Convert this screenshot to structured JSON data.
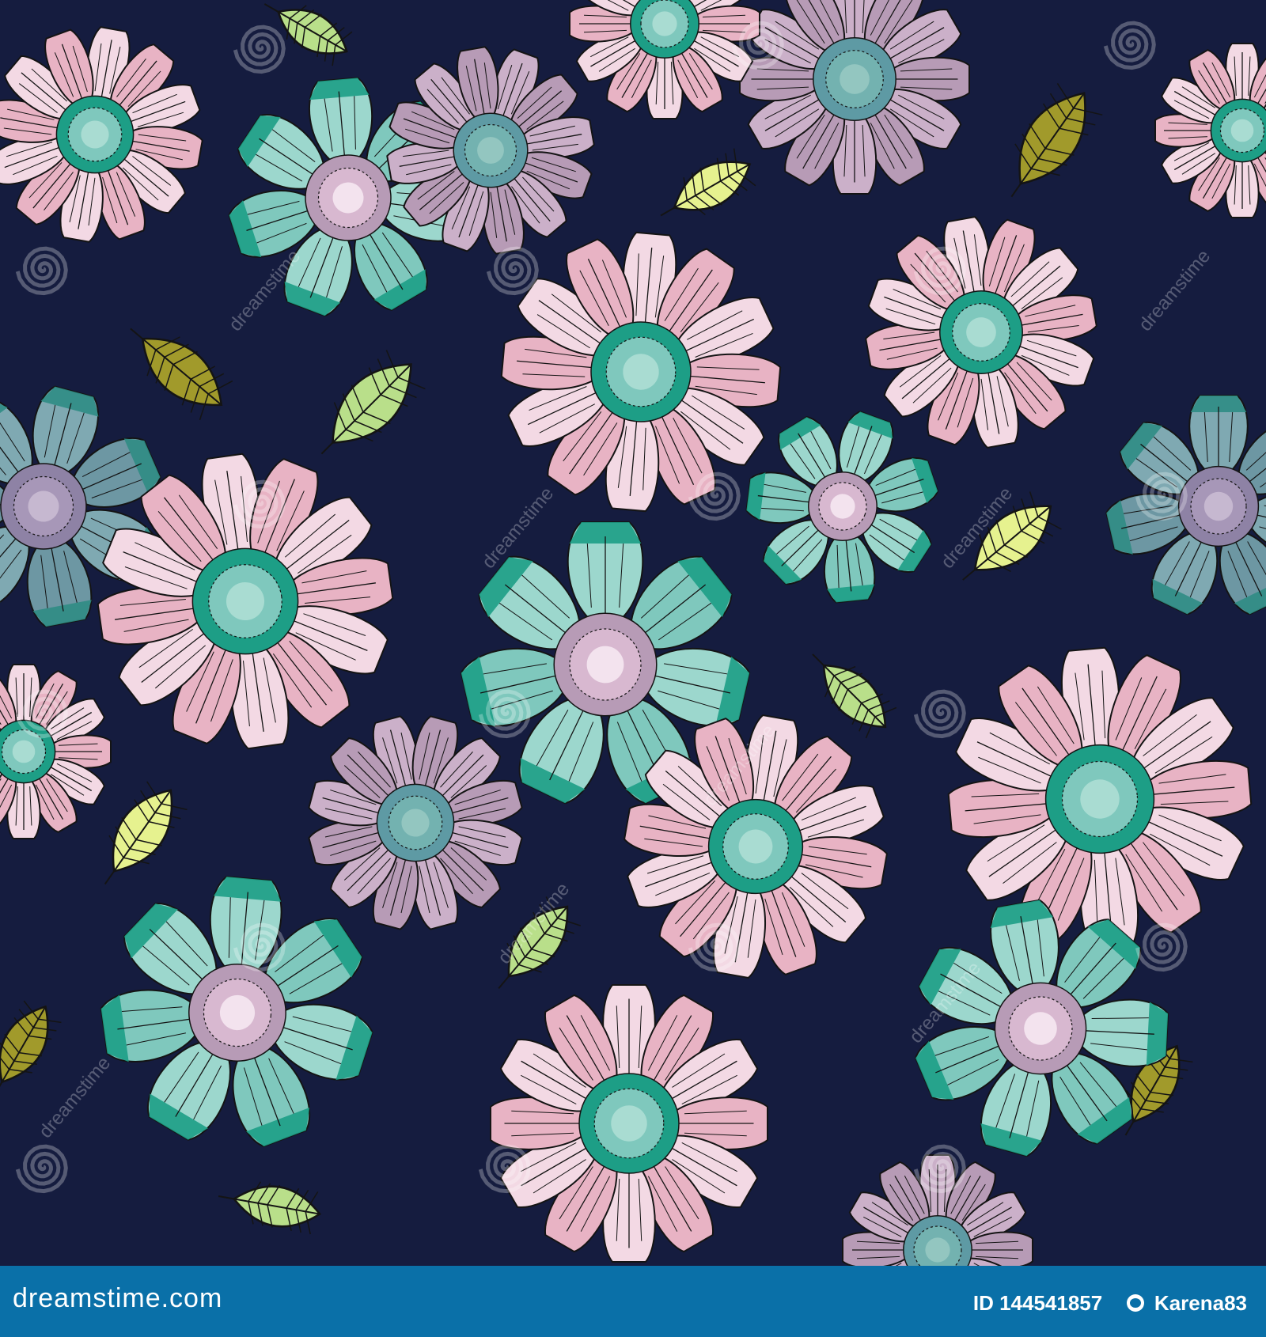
{
  "image": {
    "description_free": true,
    "background_color": "#151c3f",
    "palette": {
      "pink": "#e8b3c4",
      "pink_light": "#f3d9e4",
      "mauve": "#b79bb6",
      "teal": "#7fc8bd",
      "teal_dark": "#1d9e86",
      "leaf_light": "#e6f28f",
      "leaf_mid": "#b9df8a",
      "leaf_olive": "#a19a2b",
      "outline": "#141414"
    },
    "watermark_text": "dreamstime",
    "watermark_icon": "spiral-icon"
  },
  "footer": {
    "brand": "dreamstime.com",
    "id_label": "ID 144541857",
    "author": "Karena83",
    "bar_color": "#0a70a8"
  }
}
